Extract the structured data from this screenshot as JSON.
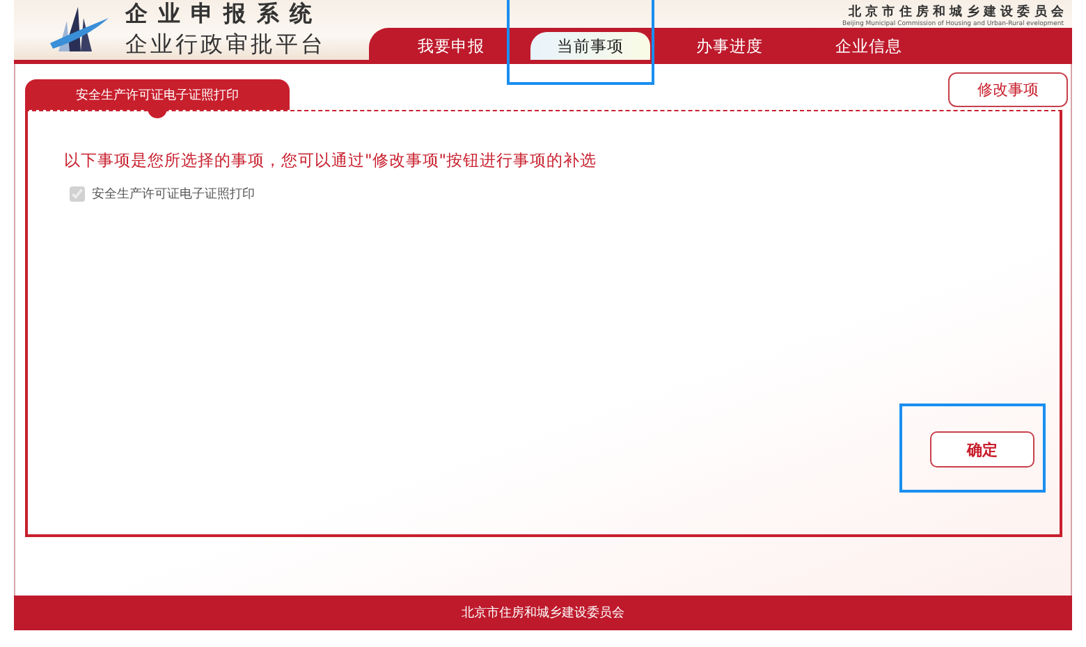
{
  "header": {
    "title_line_1": "企 业 申 报 系 统",
    "title_line_2": "企业行政审批平台",
    "agency_name": "北 京 市 住 房 和 城 乡 建 设 委 员 会",
    "agency_name_en": "Beijing Municipal Commission of Housing and Urban-Rural evelopment"
  },
  "nav_tabs": [
    {
      "label": "我要申报",
      "selected": false,
      "highlighted": false
    },
    {
      "label": "当前事项",
      "selected": true,
      "highlighted": true
    },
    {
      "label": "办事进度",
      "selected": false,
      "highlighted": false
    },
    {
      "label": "企业信息",
      "selected": false,
      "highlighted": false
    }
  ],
  "content_tab": {
    "label": "安全生产许可证电子证照打印"
  },
  "edit_button": {
    "label": "修改事项"
  },
  "notice": "以下事项是您所选择的事项，您可以通过\"修改事项\"按钮进行事项的补选",
  "items": [
    {
      "label": "安全生产许可证电子证照打印",
      "checked": true,
      "disabled": true
    }
  ],
  "confirm_button": {
    "label": "确定",
    "highlighted": true
  },
  "footer": "北京市住房和城乡建设委员会"
}
